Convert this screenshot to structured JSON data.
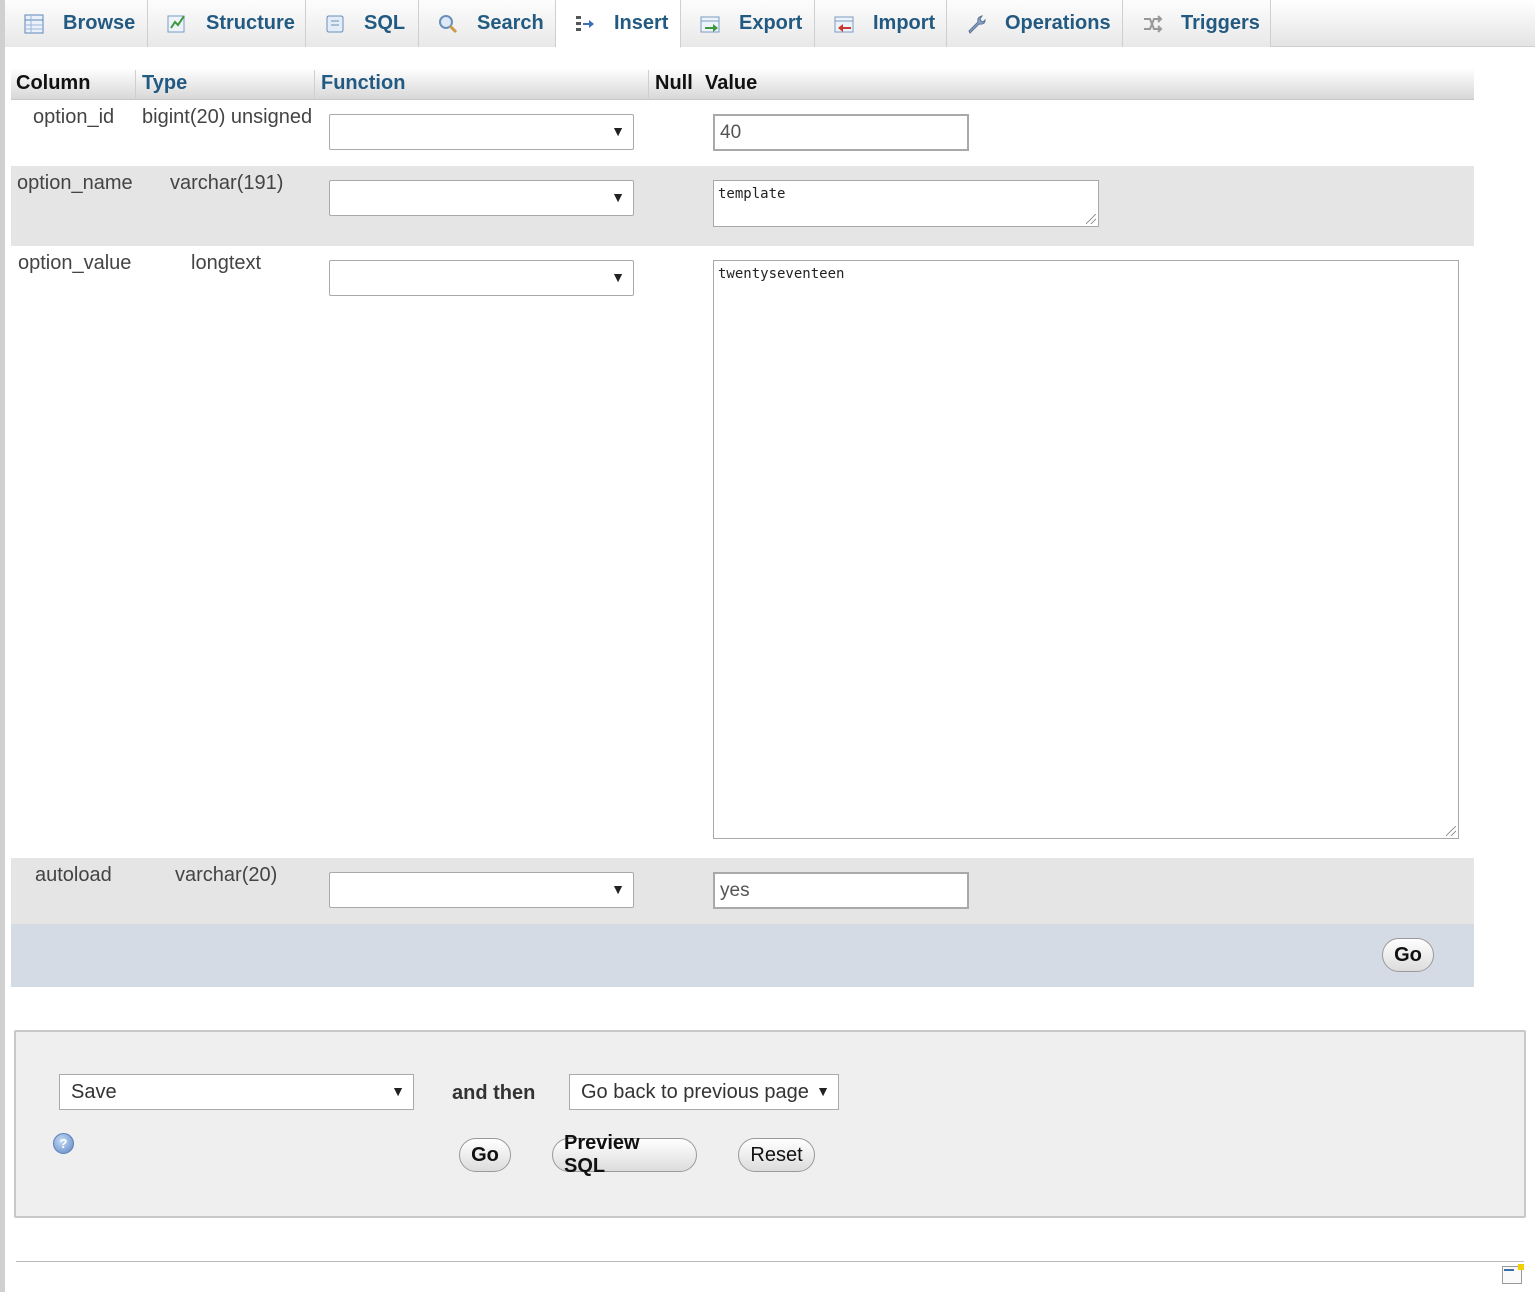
{
  "tabs": [
    {
      "label": "Browse",
      "icon": "browse-icon"
    },
    {
      "label": "Structure",
      "icon": "structure-icon"
    },
    {
      "label": "SQL",
      "icon": "sql-icon"
    },
    {
      "label": "Search",
      "icon": "search-icon"
    },
    {
      "label": "Insert",
      "icon": "insert-icon",
      "active": true
    },
    {
      "label": "Export",
      "icon": "export-icon"
    },
    {
      "label": "Import",
      "icon": "import-icon"
    },
    {
      "label": "Operations",
      "icon": "wrench-icon"
    },
    {
      "label": "Triggers",
      "icon": "triggers-icon"
    }
  ],
  "table": {
    "headers": {
      "column": "Column",
      "type": "Type",
      "function": "Function",
      "null": "Null",
      "value": "Value"
    },
    "rows": [
      {
        "column": "option_id",
        "type": "bigint(20) unsigned",
        "function": "",
        "value": "40"
      },
      {
        "column": "option_name",
        "type": "varchar(191)",
        "function": "",
        "value": "template"
      },
      {
        "column": "option_value",
        "type": "longtext",
        "function": "",
        "value": "twentyseventeen"
      },
      {
        "column": "autoload",
        "type": "varchar(20)",
        "function": "",
        "value": "yes"
      }
    ],
    "go_label": "Go"
  },
  "footer": {
    "action_select": "Save",
    "and_then": "and then",
    "after_select": "Go back to previous page",
    "go_label": "Go",
    "preview_label": "Preview SQL",
    "reset_label": "Reset",
    "help_icon": "help-icon"
  },
  "colors": {
    "tab_text": "#235a81",
    "row_alt": "#e5e5e5",
    "go_row": "#d5dbe4",
    "panel": "#efefef"
  }
}
